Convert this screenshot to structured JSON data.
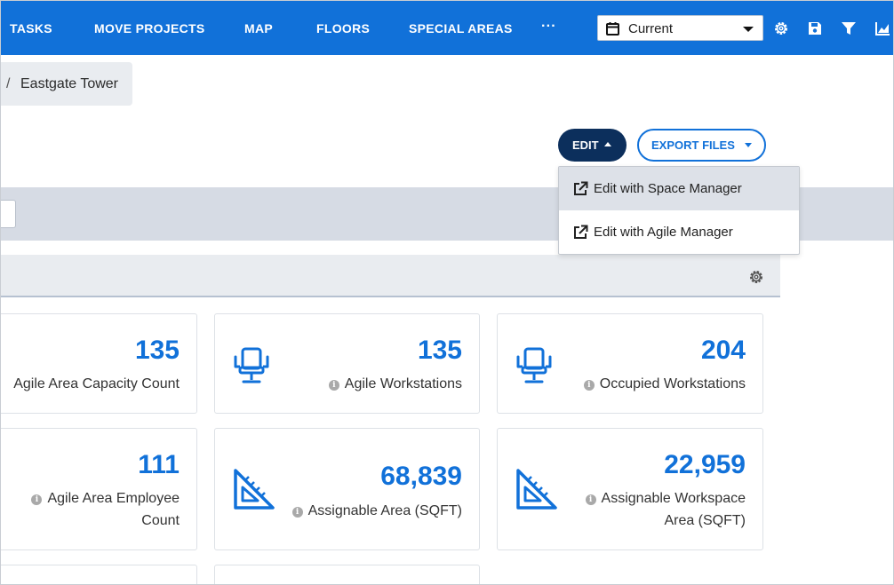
{
  "nav": {
    "items": [
      "TASKS",
      "MOVE PROJECTS",
      "MAP",
      "FLOORS",
      "SPECIAL AREAS"
    ],
    "more_label": "···",
    "period": {
      "selected": "Current",
      "icon": "calendar-icon"
    },
    "tools": [
      "settings-icon",
      "save-icon",
      "filter-icon",
      "chart-icon"
    ]
  },
  "breadcrumb": {
    "separator": "/",
    "current": "Eastgate Tower"
  },
  "actions": {
    "edit_label": "EDIT",
    "export_label": "EXPORT FILES"
  },
  "edit_menu": {
    "items": [
      "Edit with Space Manager",
      "Edit with Agile Manager"
    ],
    "highlighted_index": 0
  },
  "cards": [
    {
      "value": "135",
      "label": "Agile Area Capacity Count",
      "icon": null,
      "info": false
    },
    {
      "value": "135",
      "label": "Agile Workstations",
      "icon": "chair-icon",
      "info": true
    },
    {
      "value": "204",
      "label": "Occupied Workstations",
      "icon": "chair-icon",
      "info": true
    },
    {
      "value": "111",
      "label_line1": "Agile Area Employee",
      "label_line2": "Count",
      "icon": null,
      "info": true
    },
    {
      "value": "68,839",
      "label": "Assignable Area (SQFT)",
      "icon": "set-square-icon",
      "info": true
    },
    {
      "value": "22,959",
      "label_line1": "Assignable Workspace",
      "label_line2": "Area (SQFT)",
      "icon": "set-square-icon",
      "info": true
    }
  ],
  "colors": {
    "accent": "#1171d9",
    "dark_button": "#0c2f5c",
    "band": "#d6dbe4"
  }
}
